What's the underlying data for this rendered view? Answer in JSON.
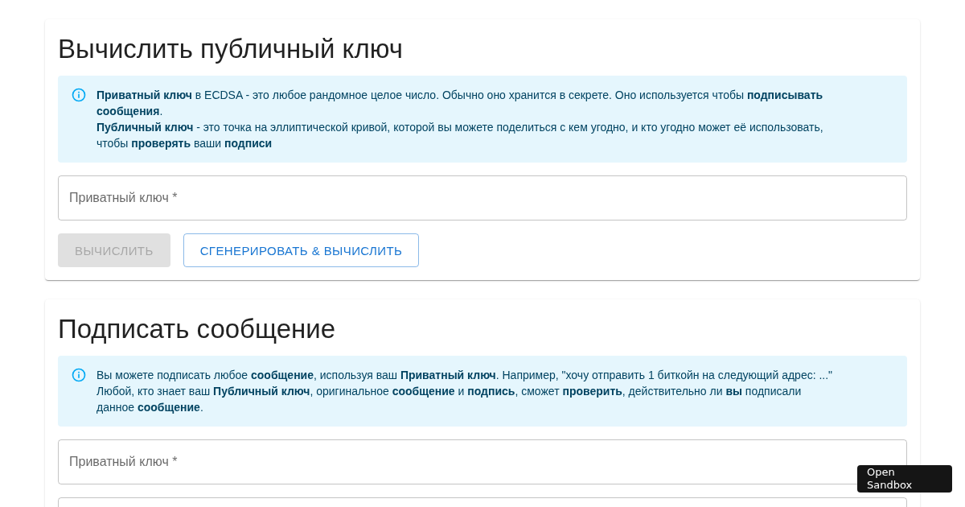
{
  "cards": [
    {
      "title": "Вычислить публичный ключ",
      "alert": [
        "**Приватный ключ** в ECDSA - это любое рандомное целое число. Обычно оно хранится в секрете. Оно используется чтобы **подписывать сообщения**.",
        "**Публичный ключ** - это точка на эллиптической кривой, которой вы можете поделиться с кем угодно, и кто угодно может её использовать, чтобы **проверять** ваши **подписи**"
      ],
      "fields": [
        {
          "kind": "text",
          "placeholder": "Приватный ключ *"
        }
      ],
      "buttons": [
        {
          "label": "ВЫЧИСЛИТЬ",
          "kind": "contained",
          "disabled": true
        },
        {
          "label": "СГЕНЕРИРОВАТЬ & ВЫЧИСЛИТЬ",
          "kind": "outlined",
          "disabled": false
        }
      ]
    },
    {
      "title": "Подписать сообщение",
      "alert": [
        "Вы можете подписать любое **сообщение**, используя ваш **Приватный ключ**. Например, \"хочу отправить 1 биткойн на следующий адрес: ...\"",
        "Любой, кто знает ваш **Публичный ключ**, оригинальное **сообщение** и **подпись**, сможет **проверить**, действительно ли **вы** подписали данное **сообщение**."
      ],
      "fields": [
        {
          "kind": "text",
          "placeholder": "Приватный ключ *"
        },
        {
          "kind": "text"
        }
      ]
    }
  ],
  "sandbox_button": "Open Sandbox"
}
